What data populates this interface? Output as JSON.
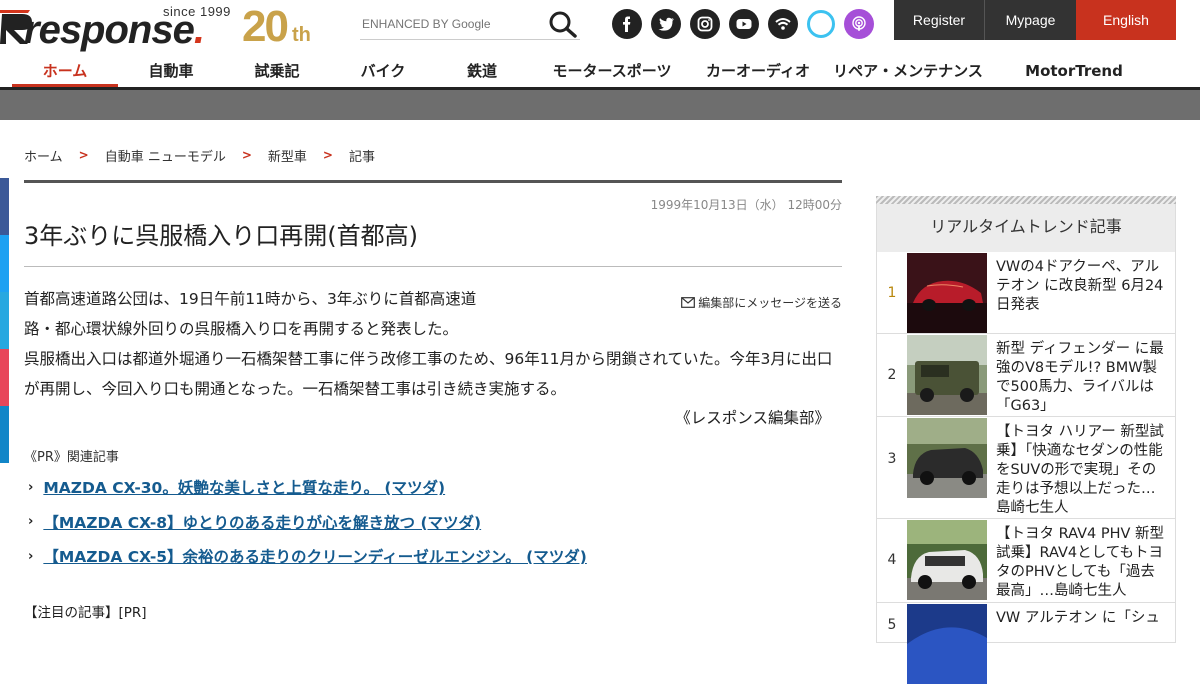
{
  "header": {
    "logo_since": "since 1999",
    "logo_word": "response",
    "logo_anniv": "20",
    "logo_anniv_suffix": "th",
    "search_placeholder": "ENHANCED BY Google",
    "social_icons": [
      "facebook-icon",
      "twitter-icon",
      "instagram-icon",
      "youtube-icon",
      "rss-icon",
      "alexa-icon",
      "podcast-icon"
    ],
    "register": "Register",
    "mypage": "Mypage",
    "english": "English"
  },
  "nav": {
    "items": [
      "ホーム",
      "自動車",
      "試乗記",
      "バイク",
      "鉄道",
      "モータースポーツ",
      "カーオーディオ",
      "リペア・メンテナンス",
      "MotorTrend"
    ]
  },
  "breadcrumb": [
    "ホーム",
    "自動車 ニューモデル",
    "新型車",
    "記事"
  ],
  "article": {
    "date": "1999年10月13日（水） 12時00分",
    "title": "3年ぶりに呉服橋入り口再開(首都高)",
    "message_link": "編集部にメッセージを送る",
    "para1": "首都高速道路公団は、19日午前11時から、3年ぶりに首都高速道路・都心環状線外回りの呉服橋入り口を再開すると発表した。",
    "para2": "呉服橋出入口は都道外堀通り一石橋架替工事に伴う改修工事のため、96年11月から閉鎖されていた。今年3月に出口が再開し、今回入り口も開通となった。一石橋架替工事は引き続き実施する。",
    "signature": "《レスポンス編集部》",
    "pr_label": "《PR》関連記事",
    "pr_links": [
      "MAZDA CX-30。妖艶な美しさと上質な走り。 (マツダ)",
      "【MAZDA CX-8】ゆとりのある走りが心を解き放つ (マツダ)",
      "【MAZDA CX-5】余裕のある走りのクリーンディーゼルエンジン。 (マツダ)"
    ],
    "featured_label": "【注目の記事】[PR]"
  },
  "sidebar": {
    "heading": "リアルタイムトレンド記事",
    "items": [
      {
        "rank": "1",
        "text": "VWの4ドアクーペ、アルテオン に改良新型 6月24日発表"
      },
      {
        "rank": "2",
        "text": "新型 ディフェンダー に最強のV8モデル!? BMW製で500馬力、ライバルは「G63」"
      },
      {
        "rank": "3",
        "text": "【トヨタ ハリアー 新型試乗】「快適なセダンの性能をSUVの形で実現」その走りは予想以上だった…島崎七生人"
      },
      {
        "rank": "4",
        "text": "【トヨタ RAV4 PHV 新型試乗】RAV4としてもトヨタのPHVとしても「過去最高」…島崎七生人"
      },
      {
        "rank": "5",
        "text": "VW アルテオン に「シュ"
      }
    ]
  },
  "colors": {
    "accent_red": "#c8321e",
    "link_blue": "#155b8f",
    "anniv_gold": "#c9a24a"
  }
}
